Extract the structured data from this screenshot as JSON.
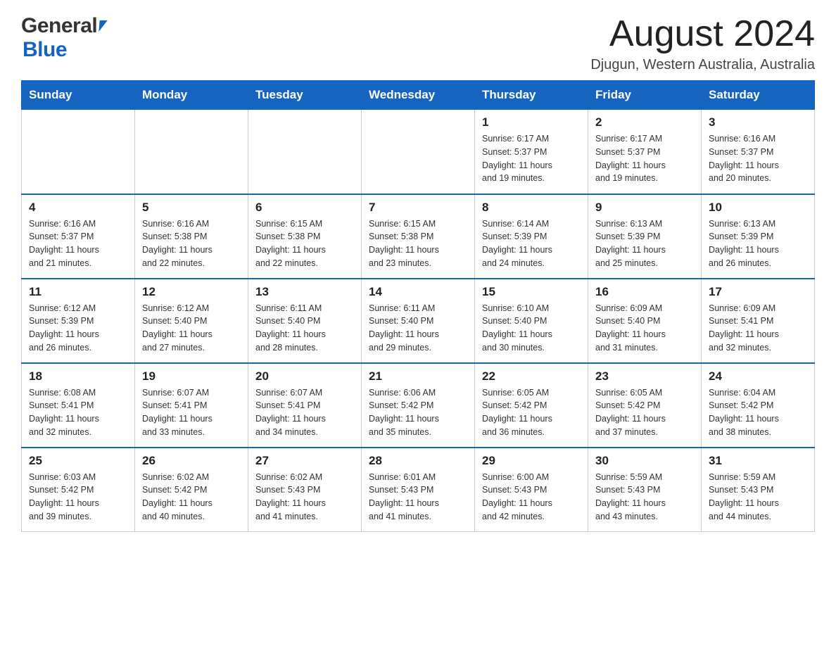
{
  "header": {
    "month_title": "August 2024",
    "location": "Djugun, Western Australia, Australia"
  },
  "logo": {
    "general": "General",
    "blue": "Blue"
  },
  "weekdays": [
    "Sunday",
    "Monday",
    "Tuesday",
    "Wednesday",
    "Thursday",
    "Friday",
    "Saturday"
  ],
  "weeks": [
    [
      {
        "day": "",
        "info": ""
      },
      {
        "day": "",
        "info": ""
      },
      {
        "day": "",
        "info": ""
      },
      {
        "day": "",
        "info": ""
      },
      {
        "day": "1",
        "info": "Sunrise: 6:17 AM\nSunset: 5:37 PM\nDaylight: 11 hours\nand 19 minutes."
      },
      {
        "day": "2",
        "info": "Sunrise: 6:17 AM\nSunset: 5:37 PM\nDaylight: 11 hours\nand 19 minutes."
      },
      {
        "day": "3",
        "info": "Sunrise: 6:16 AM\nSunset: 5:37 PM\nDaylight: 11 hours\nand 20 minutes."
      }
    ],
    [
      {
        "day": "4",
        "info": "Sunrise: 6:16 AM\nSunset: 5:37 PM\nDaylight: 11 hours\nand 21 minutes."
      },
      {
        "day": "5",
        "info": "Sunrise: 6:16 AM\nSunset: 5:38 PM\nDaylight: 11 hours\nand 22 minutes."
      },
      {
        "day": "6",
        "info": "Sunrise: 6:15 AM\nSunset: 5:38 PM\nDaylight: 11 hours\nand 22 minutes."
      },
      {
        "day": "7",
        "info": "Sunrise: 6:15 AM\nSunset: 5:38 PM\nDaylight: 11 hours\nand 23 minutes."
      },
      {
        "day": "8",
        "info": "Sunrise: 6:14 AM\nSunset: 5:39 PM\nDaylight: 11 hours\nand 24 minutes."
      },
      {
        "day": "9",
        "info": "Sunrise: 6:13 AM\nSunset: 5:39 PM\nDaylight: 11 hours\nand 25 minutes."
      },
      {
        "day": "10",
        "info": "Sunrise: 6:13 AM\nSunset: 5:39 PM\nDaylight: 11 hours\nand 26 minutes."
      }
    ],
    [
      {
        "day": "11",
        "info": "Sunrise: 6:12 AM\nSunset: 5:39 PM\nDaylight: 11 hours\nand 26 minutes."
      },
      {
        "day": "12",
        "info": "Sunrise: 6:12 AM\nSunset: 5:40 PM\nDaylight: 11 hours\nand 27 minutes."
      },
      {
        "day": "13",
        "info": "Sunrise: 6:11 AM\nSunset: 5:40 PM\nDaylight: 11 hours\nand 28 minutes."
      },
      {
        "day": "14",
        "info": "Sunrise: 6:11 AM\nSunset: 5:40 PM\nDaylight: 11 hours\nand 29 minutes."
      },
      {
        "day": "15",
        "info": "Sunrise: 6:10 AM\nSunset: 5:40 PM\nDaylight: 11 hours\nand 30 minutes."
      },
      {
        "day": "16",
        "info": "Sunrise: 6:09 AM\nSunset: 5:40 PM\nDaylight: 11 hours\nand 31 minutes."
      },
      {
        "day": "17",
        "info": "Sunrise: 6:09 AM\nSunset: 5:41 PM\nDaylight: 11 hours\nand 32 minutes."
      }
    ],
    [
      {
        "day": "18",
        "info": "Sunrise: 6:08 AM\nSunset: 5:41 PM\nDaylight: 11 hours\nand 32 minutes."
      },
      {
        "day": "19",
        "info": "Sunrise: 6:07 AM\nSunset: 5:41 PM\nDaylight: 11 hours\nand 33 minutes."
      },
      {
        "day": "20",
        "info": "Sunrise: 6:07 AM\nSunset: 5:41 PM\nDaylight: 11 hours\nand 34 minutes."
      },
      {
        "day": "21",
        "info": "Sunrise: 6:06 AM\nSunset: 5:42 PM\nDaylight: 11 hours\nand 35 minutes."
      },
      {
        "day": "22",
        "info": "Sunrise: 6:05 AM\nSunset: 5:42 PM\nDaylight: 11 hours\nand 36 minutes."
      },
      {
        "day": "23",
        "info": "Sunrise: 6:05 AM\nSunset: 5:42 PM\nDaylight: 11 hours\nand 37 minutes."
      },
      {
        "day": "24",
        "info": "Sunrise: 6:04 AM\nSunset: 5:42 PM\nDaylight: 11 hours\nand 38 minutes."
      }
    ],
    [
      {
        "day": "25",
        "info": "Sunrise: 6:03 AM\nSunset: 5:42 PM\nDaylight: 11 hours\nand 39 minutes."
      },
      {
        "day": "26",
        "info": "Sunrise: 6:02 AM\nSunset: 5:42 PM\nDaylight: 11 hours\nand 40 minutes."
      },
      {
        "day": "27",
        "info": "Sunrise: 6:02 AM\nSunset: 5:43 PM\nDaylight: 11 hours\nand 41 minutes."
      },
      {
        "day": "28",
        "info": "Sunrise: 6:01 AM\nSunset: 5:43 PM\nDaylight: 11 hours\nand 41 minutes."
      },
      {
        "day": "29",
        "info": "Sunrise: 6:00 AM\nSunset: 5:43 PM\nDaylight: 11 hours\nand 42 minutes."
      },
      {
        "day": "30",
        "info": "Sunrise: 5:59 AM\nSunset: 5:43 PM\nDaylight: 11 hours\nand 43 minutes."
      },
      {
        "day": "31",
        "info": "Sunrise: 5:59 AM\nSunset: 5:43 PM\nDaylight: 11 hours\nand 44 minutes."
      }
    ]
  ]
}
